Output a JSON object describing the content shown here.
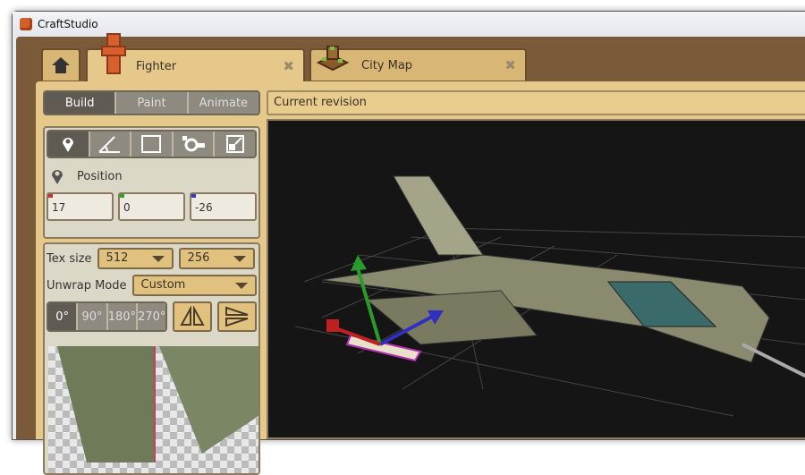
{
  "window": {
    "title": "CraftStudio"
  },
  "tabs": [
    {
      "label": "Fighter",
      "close": "✖"
    },
    {
      "label": "City Map",
      "close": "✖"
    }
  ],
  "modes": {
    "build": "Build",
    "paint": "Paint",
    "animate": "Animate"
  },
  "revision": {
    "label": "Current revision"
  },
  "transform": {
    "section": "Position",
    "x": "17",
    "y": "0",
    "z": "-26"
  },
  "uv": {
    "tex_size_label": "Tex size",
    "tex_w": "512",
    "tex_h": "256",
    "unwrap_label": "Unwrap Mode",
    "unwrap_value": "Custom",
    "rotations": [
      "0°",
      "90°",
      "180°",
      "270°"
    ]
  },
  "colors": {
    "x": "#d03030",
    "y": "#30a030",
    "z": "#3040c0"
  }
}
